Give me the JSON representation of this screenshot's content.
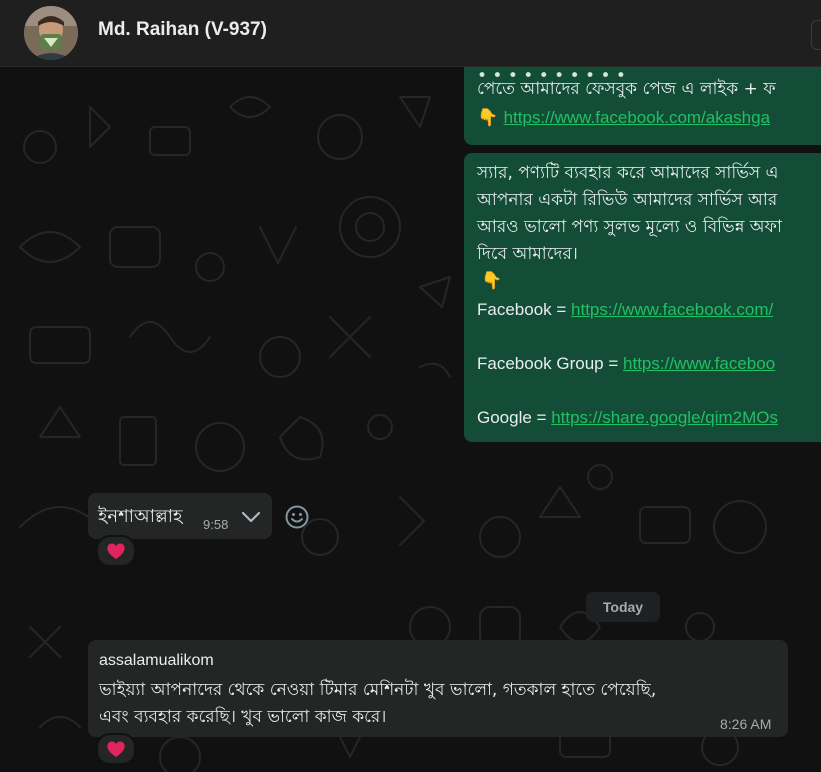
{
  "header": {
    "contact_name": "Md. Raihan (V-937)"
  },
  "colors": {
    "outgoing_bubble": "#144d37",
    "incoming_bubble": "#242626",
    "link": "#21c063",
    "background": "#111111",
    "heart": "#e0245e"
  },
  "messages": {
    "out1": {
      "line1": "পেতে আমাদের ফেসবুক পেজ এ লাইক + ফ",
      "pointer": "👇",
      "link": "https://www.facebook.com/akashga"
    },
    "out2": {
      "line1": "স্যার, পণ্যটি ব্যবহার করে আমাদের সার্ভিস এ",
      "line2": "আপনার একটা রিভিউ আমাদের সার্ভিস আর",
      "line3": "আরও ভালো পণ্য সুলভ মূল্যে ও বিভিন্ন অফা",
      "line4": "দিবে আমাদের।",
      "pointer": "👇",
      "facebook_label": "Facebook = ",
      "facebook_link": "https://www.facebook.com/",
      "group_label": "Facebook Group = ",
      "group_link": "https://www.faceboo",
      "google_label": "Google = ",
      "google_link": "https://share.google/qim2MOs"
    },
    "in1": {
      "text": "ইনশাআল্লাহ",
      "time": "9:58"
    },
    "date_separator": "Today",
    "in2": {
      "line1": "assalamualikom",
      "line2": "ভাইয়্যা আপনাদের থেকে নেওয়া টিমার মেশিনটা খুব ভালো, গতকাল হাতে পেয়েছি,",
      "line3": "এবং ব্যবহার করেছি। খুব ভালো কাজ করে।",
      "time": "8:26 AM"
    }
  },
  "icons": {
    "message_menu": "chevron-down-icon",
    "react": "emoji-smile-icon",
    "reaction": "heart-icon"
  }
}
